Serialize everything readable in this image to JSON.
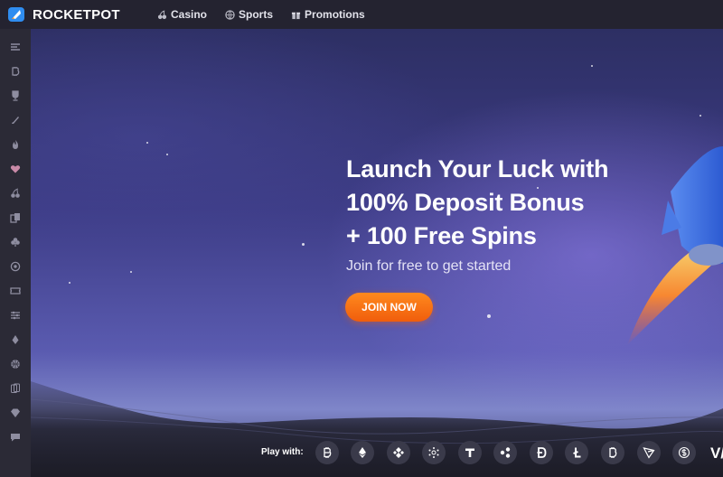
{
  "brand": {
    "name": "ROCKETPOT",
    "logo_icon": "rocket-logo-icon"
  },
  "nav": [
    {
      "label": "Casino",
      "icon": "cherries-icon"
    },
    {
      "label": "Sports",
      "icon": "ball-icon"
    },
    {
      "label": "Promotions",
      "icon": "gift-icon"
    }
  ],
  "sidebar": [
    "menu-icon",
    "bitcoin-icon",
    "trophy-icon",
    "rocket-icon",
    "fire-icon",
    "heart-icon",
    "cherries-icon",
    "cards-icon",
    "clover-icon",
    "roulette-icon",
    "ticket-icon",
    "sliders-icon",
    "drop-icon",
    "basketball-icon",
    "poker-cards-icon",
    "diamond-icon",
    "chat-icon"
  ],
  "hero": {
    "headline": [
      "Launch Your Luck with",
      "100% Deposit Bonus",
      "+ 100 Free Spins"
    ],
    "subtitle": "Join for free to get started",
    "cta": "JOIN NOW"
  },
  "payments": {
    "label": "Play with:",
    "coins": [
      "bitcoin",
      "ethereum",
      "binance",
      "cardano",
      "tether",
      "ripple",
      "dogecoin",
      "litecoin",
      "bitcoin-cash",
      "tron",
      "usd-coin"
    ],
    "more": "V/"
  },
  "colors": {
    "accent": "#f05d0c",
    "topbar": "#242330",
    "sidebar": "#2b2a36"
  }
}
